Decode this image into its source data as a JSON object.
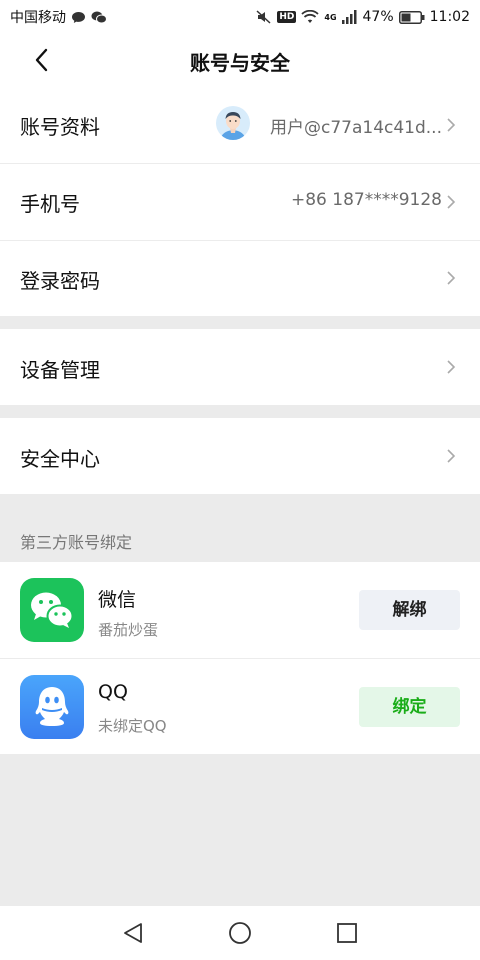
{
  "status_bar": {
    "carrier": "中国移动",
    "hd_badge": "HD",
    "network": "4G",
    "battery": "47%",
    "time": "11:02"
  },
  "header": {
    "title": "账号与安全"
  },
  "rows": {
    "profile": {
      "label": "账号资料",
      "value": "用户@c77a14c41d..."
    },
    "phone": {
      "label": "手机号",
      "value": "+86 187****9128"
    },
    "password": {
      "label": "登录密码"
    },
    "devices": {
      "label": "设备管理"
    },
    "security": {
      "label": "安全中心"
    }
  },
  "third_party": {
    "header": "第三方账号绑定",
    "accounts": [
      {
        "name": "微信",
        "sub": "番茄炒蛋",
        "button": "解绑",
        "icon": "wechat-icon"
      },
      {
        "name": "QQ",
        "sub": "未绑定QQ",
        "button": "绑定",
        "icon": "qq-icon"
      }
    ]
  },
  "colors": {
    "wechat_green": "#1cc35b",
    "qq_blue": "#3d8ef5",
    "bind_green": "#1aad19"
  }
}
